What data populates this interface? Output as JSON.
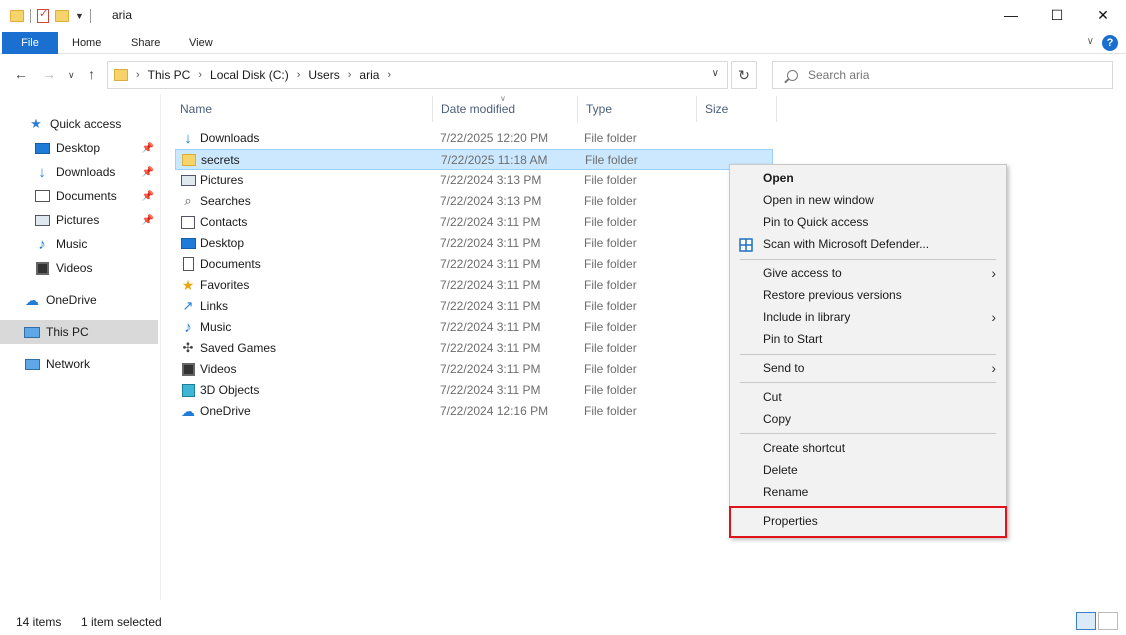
{
  "window": {
    "title": "aria",
    "minimize": "—",
    "maximize": "☐",
    "close": "✕"
  },
  "ribbon": {
    "tabs": [
      "File",
      "Home",
      "Share",
      "View"
    ],
    "help": "?"
  },
  "address": {
    "crumbs": [
      "This PC",
      "Local Disk (C:)",
      "Users",
      "aria"
    ]
  },
  "search": {
    "placeholder": "Search aria"
  },
  "sidebar": {
    "items": [
      {
        "label": "Quick access",
        "icon": "star-icon"
      },
      {
        "label": "Desktop",
        "icon": "desktop-icon",
        "pinned": true
      },
      {
        "label": "Downloads",
        "icon": "download-icon",
        "pinned": true
      },
      {
        "label": "Documents",
        "icon": "document-icon",
        "pinned": true
      },
      {
        "label": "Pictures",
        "icon": "picture-icon",
        "pinned": true
      },
      {
        "label": "Music",
        "icon": "music-icon"
      },
      {
        "label": "Videos",
        "icon": "video-icon"
      },
      {
        "label": "OneDrive",
        "icon": "cloud-icon"
      },
      {
        "label": "This PC",
        "icon": "computer-icon",
        "selected": true
      },
      {
        "label": "Network",
        "icon": "network-icon"
      }
    ]
  },
  "columns": [
    "Name",
    "Date modified",
    "Type",
    "Size"
  ],
  "files": [
    {
      "name": "Downloads",
      "date": "7/22/2025 12:20 PM",
      "type": "File folder",
      "icon": "download-icon"
    },
    {
      "name": "secrets",
      "date": "7/22/2025 11:18 AM",
      "type": "File folder",
      "icon": "folder-icon",
      "selected": true
    },
    {
      "name": "Pictures",
      "date": "7/22/2024 3:13 PM",
      "type": "File folder",
      "icon": "picture-icon"
    },
    {
      "name": "Searches",
      "date": "7/22/2024 3:13 PM",
      "type": "File folder",
      "icon": "search-icon"
    },
    {
      "name": "Contacts",
      "date": "7/22/2024 3:11 PM",
      "type": "File folder",
      "icon": "contacts-icon"
    },
    {
      "name": "Desktop",
      "date": "7/22/2024 3:11 PM",
      "type": "File folder",
      "icon": "desktop-icon"
    },
    {
      "name": "Documents",
      "date": "7/22/2024 3:11 PM",
      "type": "File folder",
      "icon": "document-icon"
    },
    {
      "name": "Favorites",
      "date": "7/22/2024 3:11 PM",
      "type": "File folder",
      "icon": "star-icon"
    },
    {
      "name": "Links",
      "date": "7/22/2024 3:11 PM",
      "type": "File folder",
      "icon": "link-icon"
    },
    {
      "name": "Music",
      "date": "7/22/2024 3:11 PM",
      "type": "File folder",
      "icon": "music-icon"
    },
    {
      "name": "Saved Games",
      "date": "7/22/2024 3:11 PM",
      "type": "File folder",
      "icon": "gamepad-icon"
    },
    {
      "name": "Videos",
      "date": "7/22/2024 3:11 PM",
      "type": "File folder",
      "icon": "video-icon"
    },
    {
      "name": "3D Objects",
      "date": "7/22/2024 3:11 PM",
      "type": "File folder",
      "icon": "cube-icon"
    },
    {
      "name": "OneDrive",
      "date": "7/22/2024 12:16 PM",
      "type": "File folder",
      "icon": "cloud-icon"
    }
  ],
  "context_menu": {
    "items": [
      {
        "label": "Open",
        "bold": true
      },
      {
        "label": "Open in new window"
      },
      {
        "label": "Pin to Quick access"
      },
      {
        "label": "Scan with Microsoft Defender...",
        "icon": "shield-icon"
      },
      {
        "separator": true
      },
      {
        "label": "Give access to",
        "submenu": true
      },
      {
        "label": "Restore previous versions"
      },
      {
        "label": "Include in library",
        "submenu": true
      },
      {
        "label": "Pin to Start"
      },
      {
        "separator": true
      },
      {
        "label": "Send to",
        "submenu": true
      },
      {
        "separator": true
      },
      {
        "label": "Cut"
      },
      {
        "label": "Copy"
      },
      {
        "separator": true
      },
      {
        "label": "Create shortcut"
      },
      {
        "label": "Delete"
      },
      {
        "label": "Rename"
      },
      {
        "separator": true
      },
      {
        "label": "Properties",
        "highlighted": true
      }
    ]
  },
  "status": {
    "count": "14 items",
    "selection": "1 item selected"
  },
  "colors": {
    "accent": "#1a6fd0",
    "selection": "#cce8ff",
    "highlight_border": "#e0121c",
    "folder": "#f6d36b"
  }
}
